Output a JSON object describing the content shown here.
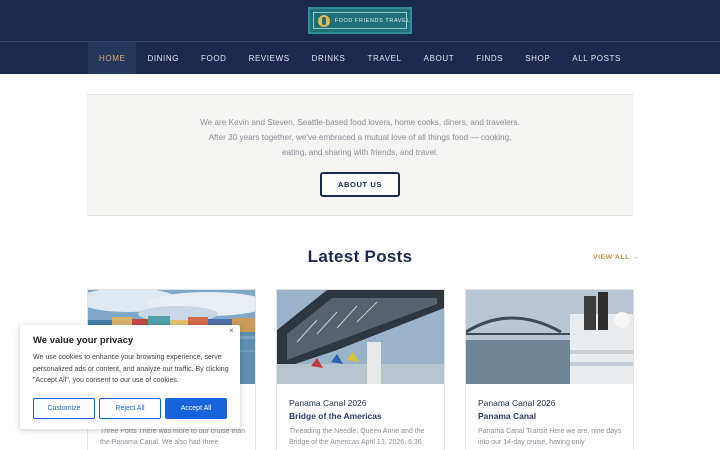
{
  "brand": {
    "logo_text": "FOOD FRIENDS TRAVEL"
  },
  "nav": {
    "items": [
      {
        "label": "HOME"
      },
      {
        "label": "DINING"
      },
      {
        "label": "FOOD"
      },
      {
        "label": "REVIEWS"
      },
      {
        "label": "DRINKS"
      },
      {
        "label": "TRAVEL"
      },
      {
        "label": "ABOUT"
      },
      {
        "label": "FINDS"
      },
      {
        "label": "SHOP"
      },
      {
        "label": "ALL POSTS"
      }
    ],
    "active_label": "HOME"
  },
  "about": {
    "text": "We are Kevin and Steven, Seattle-based food lovers, home cooks, diners, and travelers. After 30 years together, we've embraced a mutual love of all things food — cooking, eating, and sharing with friends, and travel.",
    "button_label": "ABOUT US"
  },
  "latest": {
    "title": "Latest Posts",
    "view_all_label": "VIEW ALL →"
  },
  "posts": [
    {
      "category": "",
      "title": "",
      "excerpt": "Three Ports There was more to our cruise than the Panama Canal. We also had three"
    },
    {
      "category": "Panama Canal 2026",
      "title": "Bridge of the Americas",
      "excerpt": "Threading the Needle: Queen Anne and the Bridge of the Americas April 13, 2026, 6:36"
    },
    {
      "category": "Panama Canal 2026",
      "title": "Panama Canal",
      "excerpt": "Panama Canal Transit   Here we are, nine days into our 14-day cruise, having only"
    }
  ],
  "cookie": {
    "title": "We value your privacy",
    "body": "We use cookies to enhance your browsing experience, serve personalized ads or content, and analyze our traffic. By clicking \"Accept All\", you consent to our use of cookies.",
    "customize_label": "Customize",
    "reject_label": "Reject All",
    "accept_label": "Accept All",
    "close_label": "×"
  },
  "colors": {
    "header_bg": "#1b2a4e",
    "accent_gold": "#b98f4a",
    "cookie_blue": "#1863dc"
  }
}
